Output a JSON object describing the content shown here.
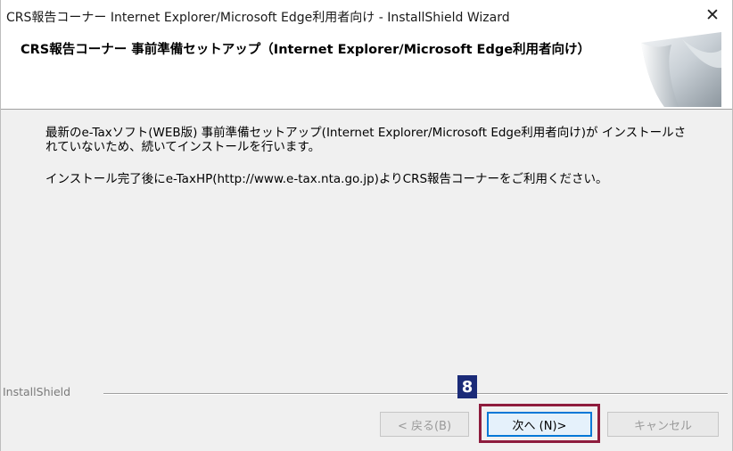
{
  "window": {
    "title": "CRS報告コーナー Internet Explorer/Microsoft Edge利用者向け - InstallShield Wizard",
    "close_glyph": "✕"
  },
  "banner": {
    "title": "CRS報告コーナー 事前準備セットアップ（Internet Explorer/Microsoft Edge利用者向け）"
  },
  "content": {
    "message1": "最新のe-Taxソフト(WEB版) 事前準備セットアップ(Internet Explorer/Microsoft Edge利用者向け)が インストールされていないため、続いてインストールを行います。",
    "message2": "インストール完了後にe-TaxHP(http://www.e-tax.nta.go.jp)よりCRS報告コーナーをご利用ください。"
  },
  "footer": {
    "brand": "InstallShield",
    "buttons": {
      "back": "< 戻る(B)",
      "next": "次へ (N)>",
      "cancel": "キャンセル"
    }
  },
  "annotation": {
    "step_number": "8",
    "highlight_color": "#8e1c3d",
    "badge_color": "#1b2b78"
  },
  "colors": {
    "accent": "#0078d7",
    "dialog_background": "#f0f0f0"
  }
}
